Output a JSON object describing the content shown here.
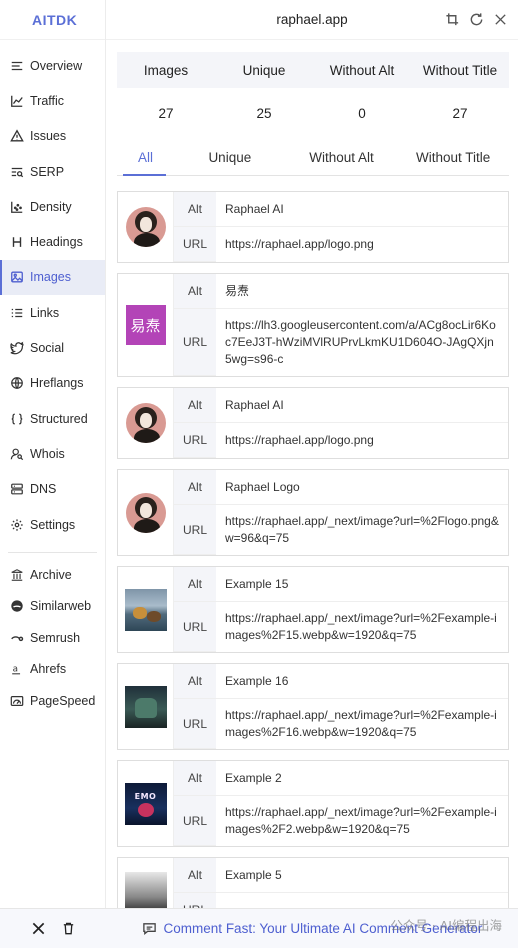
{
  "sidebar": {
    "brand": "AITDK",
    "items": [
      {
        "label": "Overview",
        "icon": "menu-lines-icon"
      },
      {
        "label": "Traffic",
        "icon": "line-chart-icon"
      },
      {
        "label": "Issues",
        "icon": "warning-icon"
      },
      {
        "label": "SERP",
        "icon": "search-list-icon"
      },
      {
        "label": "Density",
        "icon": "scatter-chart-icon"
      },
      {
        "label": "Headings",
        "icon": "heading-icon"
      },
      {
        "label": "Images",
        "icon": "image-icon"
      },
      {
        "label": "Links",
        "icon": "list-icon"
      },
      {
        "label": "Social",
        "icon": "twitter-bird-icon"
      },
      {
        "label": "Hreflangs",
        "icon": "globe-icon"
      },
      {
        "label": "Structured",
        "icon": "braces-icon"
      },
      {
        "label": "Whois",
        "icon": "user-search-icon"
      },
      {
        "label": "DNS",
        "icon": "server-icon"
      },
      {
        "label": "Settings",
        "icon": "gear-icon"
      }
    ],
    "active": "Images",
    "tools": [
      {
        "label": "Archive",
        "icon": "archive-icon"
      },
      {
        "label": "Similarweb",
        "icon": "similarweb-icon"
      },
      {
        "label": "Semrush",
        "icon": "semrush-icon"
      },
      {
        "label": "Ahrefs",
        "icon": "ahrefs-icon"
      },
      {
        "label": "PageSpeed",
        "icon": "pagespeed-icon"
      }
    ]
  },
  "header": {
    "title": "raphael.app"
  },
  "stats": {
    "headers": [
      "Images",
      "Unique",
      "Without Alt",
      "Without Title"
    ],
    "values": [
      "27",
      "25",
      "0",
      "27"
    ]
  },
  "tabs": [
    "All",
    "Unique",
    "Without Alt",
    "Without Title"
  ],
  "active_tab": "All",
  "row_labels": {
    "alt": "Alt",
    "url": "URL"
  },
  "images": [
    {
      "alt": "Raphael AI",
      "url": "https://raphael.app/logo.png"
    },
    {
      "alt": "易焘",
      "url": "https://lh3.googleusercontent.com/a/ACg8ocLir6Koc7EeJ3T-hWziMVlRUPrvLkmKU1D604O-JAgQXjn5wg=s96-c",
      "thumb_text": "易焘"
    },
    {
      "alt": "Raphael AI",
      "url": "https://raphael.app/logo.png"
    },
    {
      "alt": "Raphael Logo",
      "url": "https://raphael.app/_next/image?url=%2Flogo.png&w=96&q=75"
    },
    {
      "alt": "Example 15",
      "url": "https://raphael.app/_next/image?url=%2Fexample-images%2F15.webp&w=1920&q=75"
    },
    {
      "alt": "Example 16",
      "url": "https://raphael.app/_next/image?url=%2Fexample-images%2F16.webp&w=1920&q=75"
    },
    {
      "alt": "Example 2",
      "url": "https://raphael.app/_next/image?url=%2Fexample-images%2F2.webp&w=1920&q=75",
      "thumb_text": "EMO"
    },
    {
      "alt": "Example 5",
      "url": ""
    }
  ],
  "footer": {
    "link_text": "Comment Fast: Your Ultimate AI Comment Generator",
    "watermark": "公众号 · AI编程出海"
  },
  "colors": {
    "accent": "#5b6fd6",
    "active_bg": "#e9ecf6",
    "stats_bg": "#f4f5f9"
  }
}
